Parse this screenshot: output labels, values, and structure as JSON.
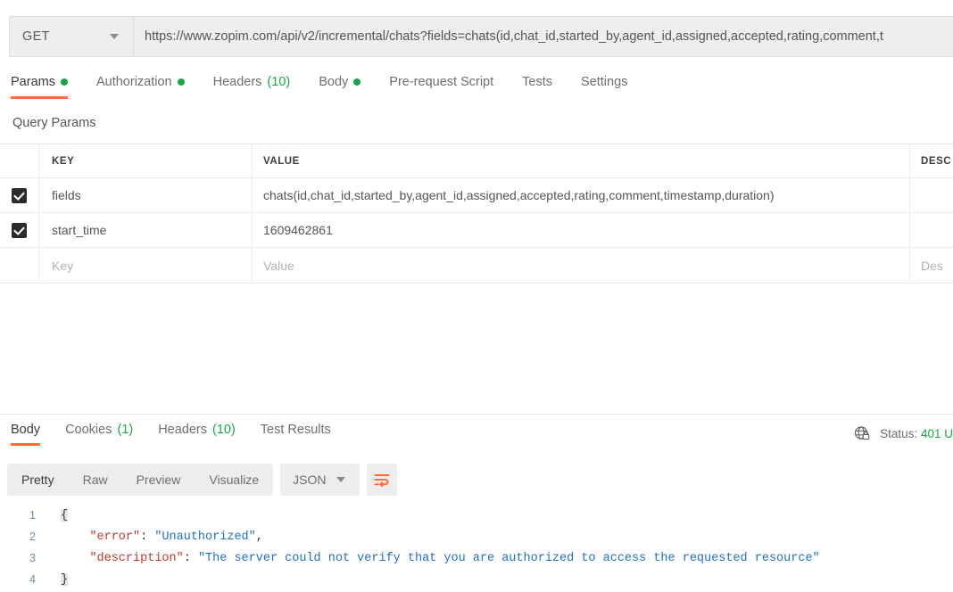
{
  "request": {
    "method": "GET",
    "url": "https://www.zopim.com/api/v2/incremental/chats?fields=chats(id,chat_id,started_by,agent_id,assigned,accepted,rating,comment,t",
    "tabs": [
      {
        "label": "Params",
        "marker": "dot",
        "active": true
      },
      {
        "label": "Authorization",
        "marker": "dot",
        "active": false
      },
      {
        "label": "Headers",
        "marker": "count",
        "count": "(10)",
        "active": false
      },
      {
        "label": "Body",
        "marker": "dot",
        "active": false
      },
      {
        "label": "Pre-request Script",
        "marker": "none",
        "active": false
      },
      {
        "label": "Tests",
        "marker": "none",
        "active": false
      },
      {
        "label": "Settings",
        "marker": "none",
        "active": false
      }
    ]
  },
  "query_params": {
    "section_title": "Query Params",
    "columns": {
      "key": "KEY",
      "value": "VALUE",
      "description": "DESC"
    },
    "rows": [
      {
        "checked": true,
        "key": "fields",
        "value": "chats(id,chat_id,started_by,agent_id,assigned,accepted,rating,comment,timestamp,duration)",
        "description": ""
      },
      {
        "checked": true,
        "key": "start_time",
        "value": "1609462861",
        "description": ""
      }
    ],
    "placeholder_row": {
      "key_placeholder": "Key",
      "value_placeholder": "Value",
      "description_placeholder": "Des"
    }
  },
  "response": {
    "tabs": [
      {
        "label": "Body",
        "marker": "none",
        "active": true
      },
      {
        "label": "Cookies",
        "marker": "count",
        "count": "(1)",
        "active": false
      },
      {
        "label": "Headers",
        "marker": "count",
        "count": "(10)",
        "active": false
      },
      {
        "label": "Test Results",
        "marker": "none",
        "active": false
      }
    ],
    "status": {
      "label": "Status:",
      "code": "401 U"
    },
    "view_modes": [
      {
        "label": "Pretty",
        "active": true
      },
      {
        "label": "Raw",
        "active": false
      },
      {
        "label": "Preview",
        "active": false
      },
      {
        "label": "Visualize",
        "active": false
      }
    ],
    "format": "JSON",
    "body_lines": [
      {
        "number": "1",
        "open_brace": "{"
      },
      {
        "number": "2",
        "key": "\"error\"",
        "colon": ": ",
        "value": "\"Unauthorized\"",
        "comma": ","
      },
      {
        "number": "3",
        "key": "\"description\"",
        "colon": ": ",
        "value": "\"The server could not verify that you are authorized to access the requested resource\"",
        "comma": ""
      },
      {
        "number": "4",
        "close_brace": "}"
      }
    ]
  },
  "colors": {
    "accent": "#ff6c37",
    "success": "#1ba548",
    "json_key": "#c0392b",
    "json_string": "#1f6fd0"
  }
}
